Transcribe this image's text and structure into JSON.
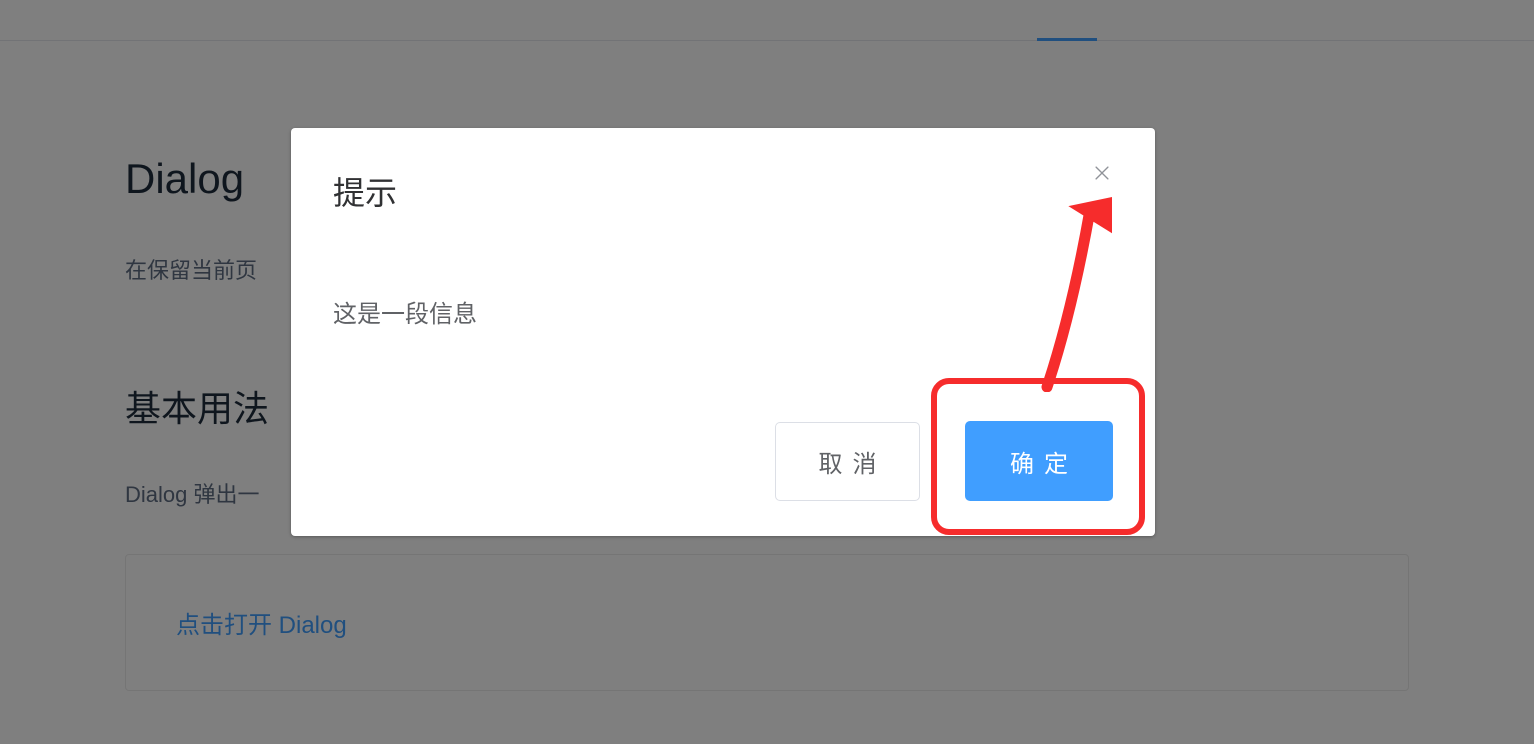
{
  "page": {
    "title": "Dialog",
    "description": "在保留当前页",
    "section_title": "基本用法",
    "section_description": "Dialog 弹出一",
    "demo_link": "点击打开 Dialog"
  },
  "dialog": {
    "title": "提示",
    "body": "这是一段信息",
    "cancel": "取消",
    "confirm": "确定"
  }
}
